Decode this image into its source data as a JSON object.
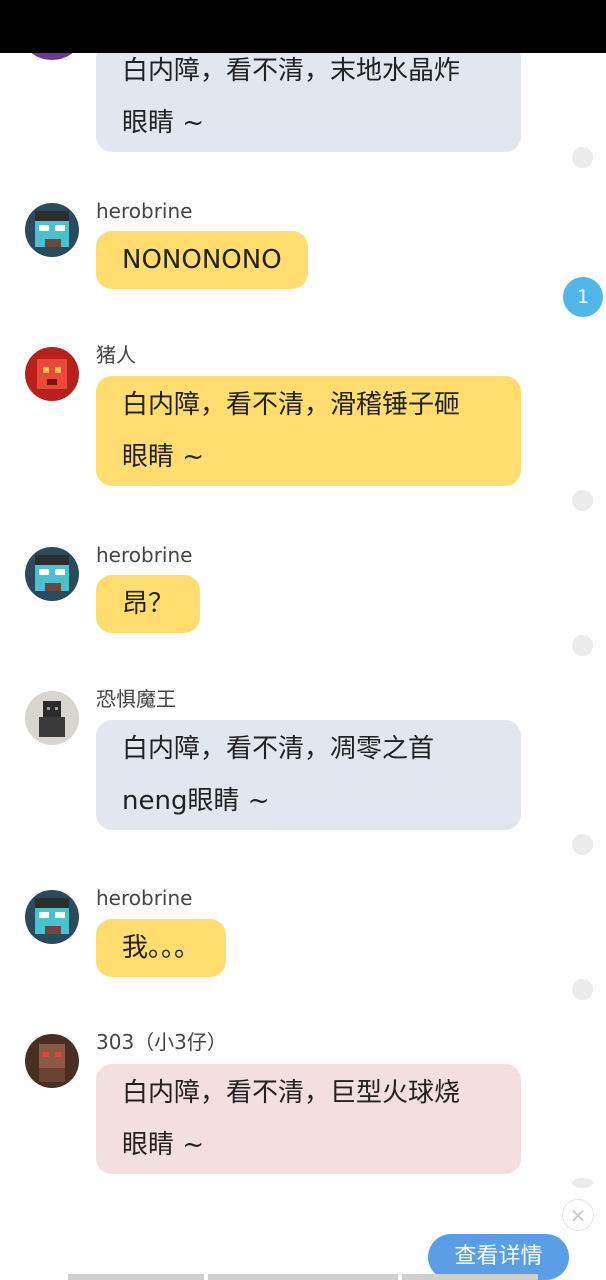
{
  "messages": [
    {
      "sender": "",
      "lines": [
        "白内障，看不清，末地水晶炸",
        "眼睛 ~"
      ],
      "style": "gray",
      "avatar": "purple-avatar"
    },
    {
      "sender": "herobrine",
      "lines": [
        "NONONONO"
      ],
      "style": "yellow",
      "avatar": "herobrine-avatar"
    },
    {
      "sender": "猪人",
      "lines": [
        "白内障，看不清，滑稽锤子砸",
        "眼睛 ~"
      ],
      "style": "yellow",
      "avatar": "pigman-avatar"
    },
    {
      "sender": "herobrine",
      "lines": [
        "昂？"
      ],
      "style": "yellow",
      "avatar": "herobrine-avatar"
    },
    {
      "sender": "恐惧魔王",
      "lines": [
        "白内障，看不清，凋零之首",
        "neng眼睛 ~"
      ],
      "style": "gray",
      "avatar": "dread-lord-avatar"
    },
    {
      "sender": "herobrine",
      "lines": [
        "我。。。"
      ],
      "style": "yellow",
      "avatar": "herobrine-avatar"
    },
    {
      "sender": "303（小3仔）",
      "lines": [
        "白内障，看不清，巨型火球烧",
        "眼睛 ~"
      ],
      "style": "pink",
      "avatar": "303-avatar"
    }
  ],
  "unread_badge": "1",
  "close_icon": "×",
  "details_button": "查看详情",
  "colors": {
    "yellow_bubble": "#ffdd6e",
    "gray_bubble": "#e2e7ef",
    "pink_bubble": "#f3dfe0",
    "badge": "#4fb8e8",
    "details_button": "#5a9ee8"
  }
}
